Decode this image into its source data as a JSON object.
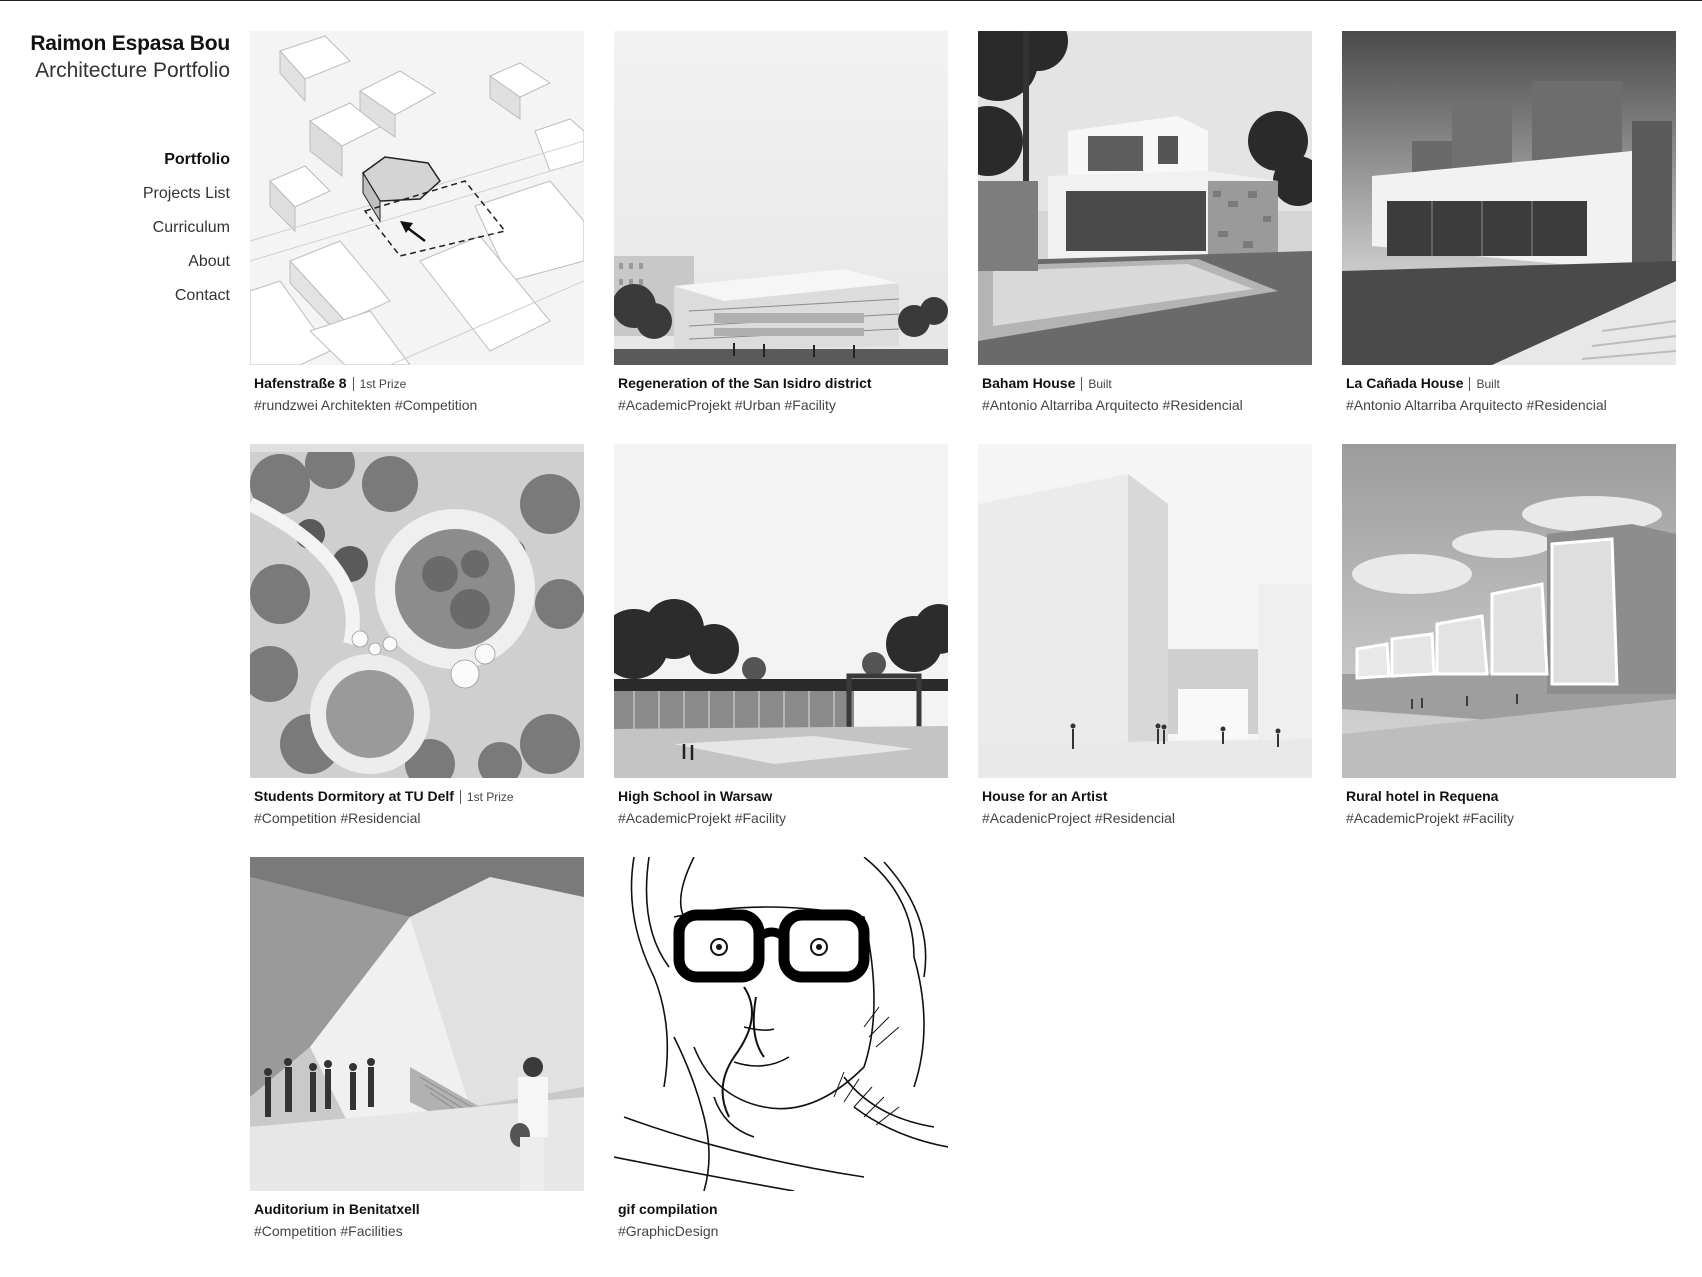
{
  "site": {
    "name": "Raimon Espasa Bou",
    "subtitle": "Architecture Portfolio"
  },
  "nav": {
    "items": [
      {
        "label": "Portfolio",
        "active": true
      },
      {
        "label": "Projects List"
      },
      {
        "label": "Curriculum"
      },
      {
        "label": "About"
      },
      {
        "label": "Contact"
      }
    ]
  },
  "projects": [
    {
      "title": "Hafenstraße 8",
      "note": "1st Prize",
      "tags": "#rundzwei Architekten #Competition",
      "image": "axonometric-site-plan"
    },
    {
      "title": "Regeneration of the San Isidro district",
      "note": "",
      "tags": "#AcademicProjekt #Urban #Facility",
      "image": "building-render"
    },
    {
      "title": "Baham House",
      "note": "Built",
      "tags": "#Antonio Altarriba Arquitecto #Residencial",
      "image": "house-with-pool-photo"
    },
    {
      "title": "La Cañada House",
      "note": "Built",
      "tags": "#Antonio Altarriba Arquitecto #Residencial",
      "image": "house-photo"
    },
    {
      "title": "Students Dormitory at TU Delf",
      "note": "1st Prize",
      "tags": "#Competition #Residencial",
      "image": "site-plan-aerial"
    },
    {
      "title": "High School in Warsaw",
      "note": "",
      "tags": "#AcademicProjekt #Facility",
      "image": "school-render"
    },
    {
      "title": "House for an Artist",
      "note": "",
      "tags": "#AcadenicProject #Residencial",
      "image": "artist-house-render"
    },
    {
      "title": "Rural hotel in Requena",
      "note": "",
      "tags": "#AcademicProjekt #Facility",
      "image": "hotel-render"
    },
    {
      "title": "Auditorium in Benitatxell",
      "note": "",
      "tags": "#Competition #Facilities",
      "image": "auditorium-interior-render"
    },
    {
      "title": "gif compilation",
      "note": "",
      "tags": "#GraphicDesign",
      "image": "portrait-drawing"
    }
  ]
}
